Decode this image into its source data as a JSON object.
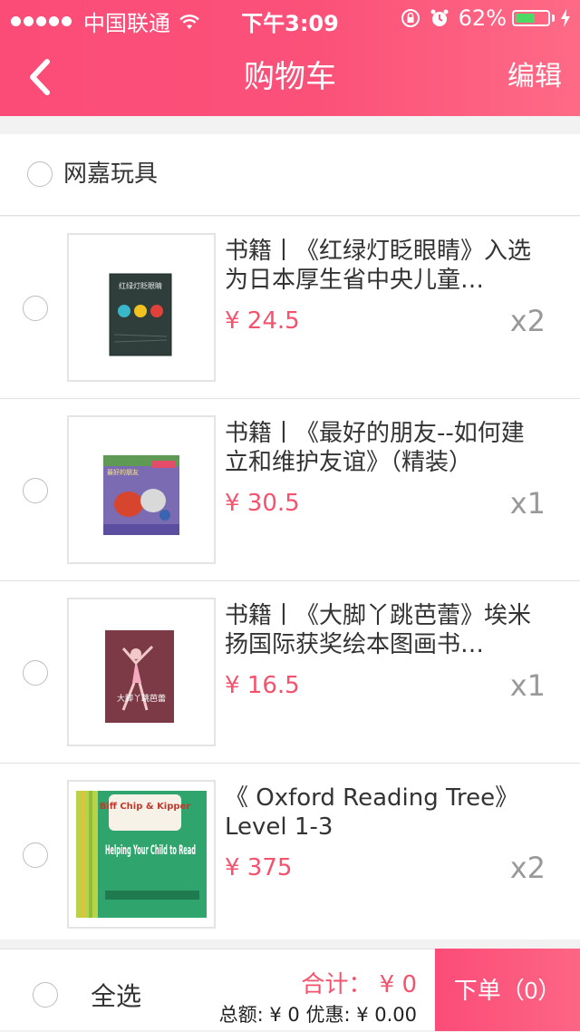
{
  "status_bar": {
    "carrier": "中国联通",
    "time": "下午3:09",
    "battery_percent": "62%",
    "battery_level": 0.62,
    "icons": [
      "signal-dots-icon",
      "wifi-icon",
      "orientation-lock-icon",
      "alarm-icon",
      "battery-icon",
      "charging-icon"
    ]
  },
  "nav": {
    "back_icon": "chevron-left-icon",
    "title": "购物车",
    "edit_label": "编辑"
  },
  "store": {
    "name": "网嘉玩具"
  },
  "items": [
    {
      "title": "书籍丨《红绿灯眨眼睛》入选为日本厚生省中央儿童福利审议会推荐图书",
      "title_visible": "书籍丨《红绿灯眨眼睛》入选为日本厚生省中央儿童…",
      "price": "¥ 24.5",
      "qty": "x2",
      "cover_text": "红绿灯眨眼睛"
    },
    {
      "title_visible": "书籍丨《最好的朋友--如何建立和维护友谊》（精装）",
      "price": "¥ 30.5",
      "qty": "x1",
      "cover_text": "最好的朋友"
    },
    {
      "title_visible": "书籍丨《大脚丫跳芭蕾》埃米扬国际获奖绘本图画书…",
      "price": "¥ 16.5",
      "qty": "x1",
      "cover_text": "大脚丫跳芭蕾"
    },
    {
      "title_visible": "《 Oxford Reading Tree》Level 1-3",
      "price": "¥ 375",
      "qty": "x2",
      "cover_text_1": "Biff Chip & Kipper",
      "cover_text_2": "Helping Your Child to Read"
    }
  ],
  "bottom": {
    "select_all": "全选",
    "total_line": "合计： ¥ 0",
    "summary_line": "总额: ¥ 0 优惠: ¥ 0.00",
    "order_button": "下单（0）"
  },
  "colors": {
    "accent": "#fb4c78",
    "price": "#f5526e"
  }
}
